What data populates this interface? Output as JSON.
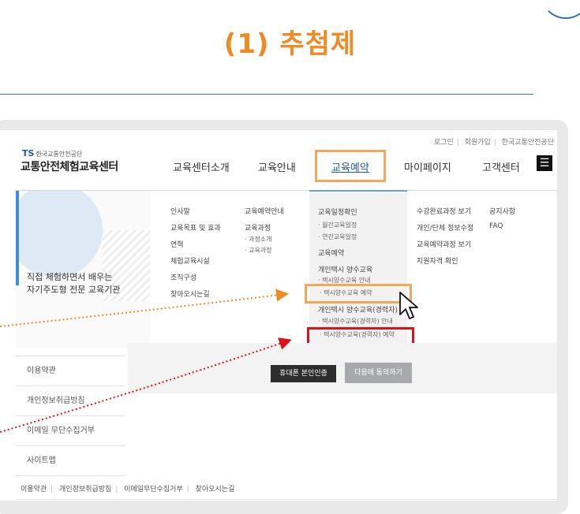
{
  "slide": {
    "title": "(1) 추첨제"
  },
  "site": {
    "utility_links": [
      "로그인",
      "회원가입",
      "한국교통안전공단"
    ],
    "logo_mark": "TS",
    "logo_org": "한국교통안전공단",
    "logo_name": "교통안전체험교육센터",
    "gnb": [
      "교육센터소개",
      "교육안내",
      "교육예약",
      "마이페이지",
      "고객센터"
    ],
    "menu_icon": "☰"
  },
  "mega_menu": {
    "hero_text": [
      "직접 체험하면서 배우는",
      "자기주도형 전문 교육기관"
    ],
    "col1": [
      "인사말",
      "교육목표 및 효과",
      "연혁",
      "체험교육시설",
      "조직구성",
      "찾아오시는길"
    ],
    "col2": [
      "교육예약안내",
      "교육과정",
      "· 과정소개",
      "· 교육과정"
    ],
    "col3": [
      "교육일정확인",
      "· 월간교육일정",
      "· 연간교육일정",
      "교육예약",
      "개인택시 양수교육",
      "· 택시양수교육 안내",
      "· 택시양수교육 예약",
      "개인택시 양수교육(경력자)",
      "· 택시양수교육(경력자) 안내",
      "· 택시양수교육(경력자) 예약"
    ],
    "col4": [
      "수강완료과정 보기",
      "개인/단체 정보수정",
      "교육예약과정 보기",
      "지원자격 확인"
    ],
    "col5": [
      "공지사항",
      "FAQ"
    ]
  },
  "side_list": [
    "이용약관",
    "개인정보취급방침",
    "이메일 무단수집거부",
    "사이트맵"
  ],
  "buttons": {
    "verify": "휴대폰 본인인증",
    "agree": "다음에 동의하기"
  },
  "footer_links": [
    "이용약관",
    "개인정보취급방침",
    "이메일무단수집거부",
    "찾아오시는길"
  ],
  "colors": {
    "title": "#f08a24",
    "highlight_orange": "#f0a85a",
    "highlight_red": "#e01018",
    "brand_blue": "#1e5aa8"
  }
}
